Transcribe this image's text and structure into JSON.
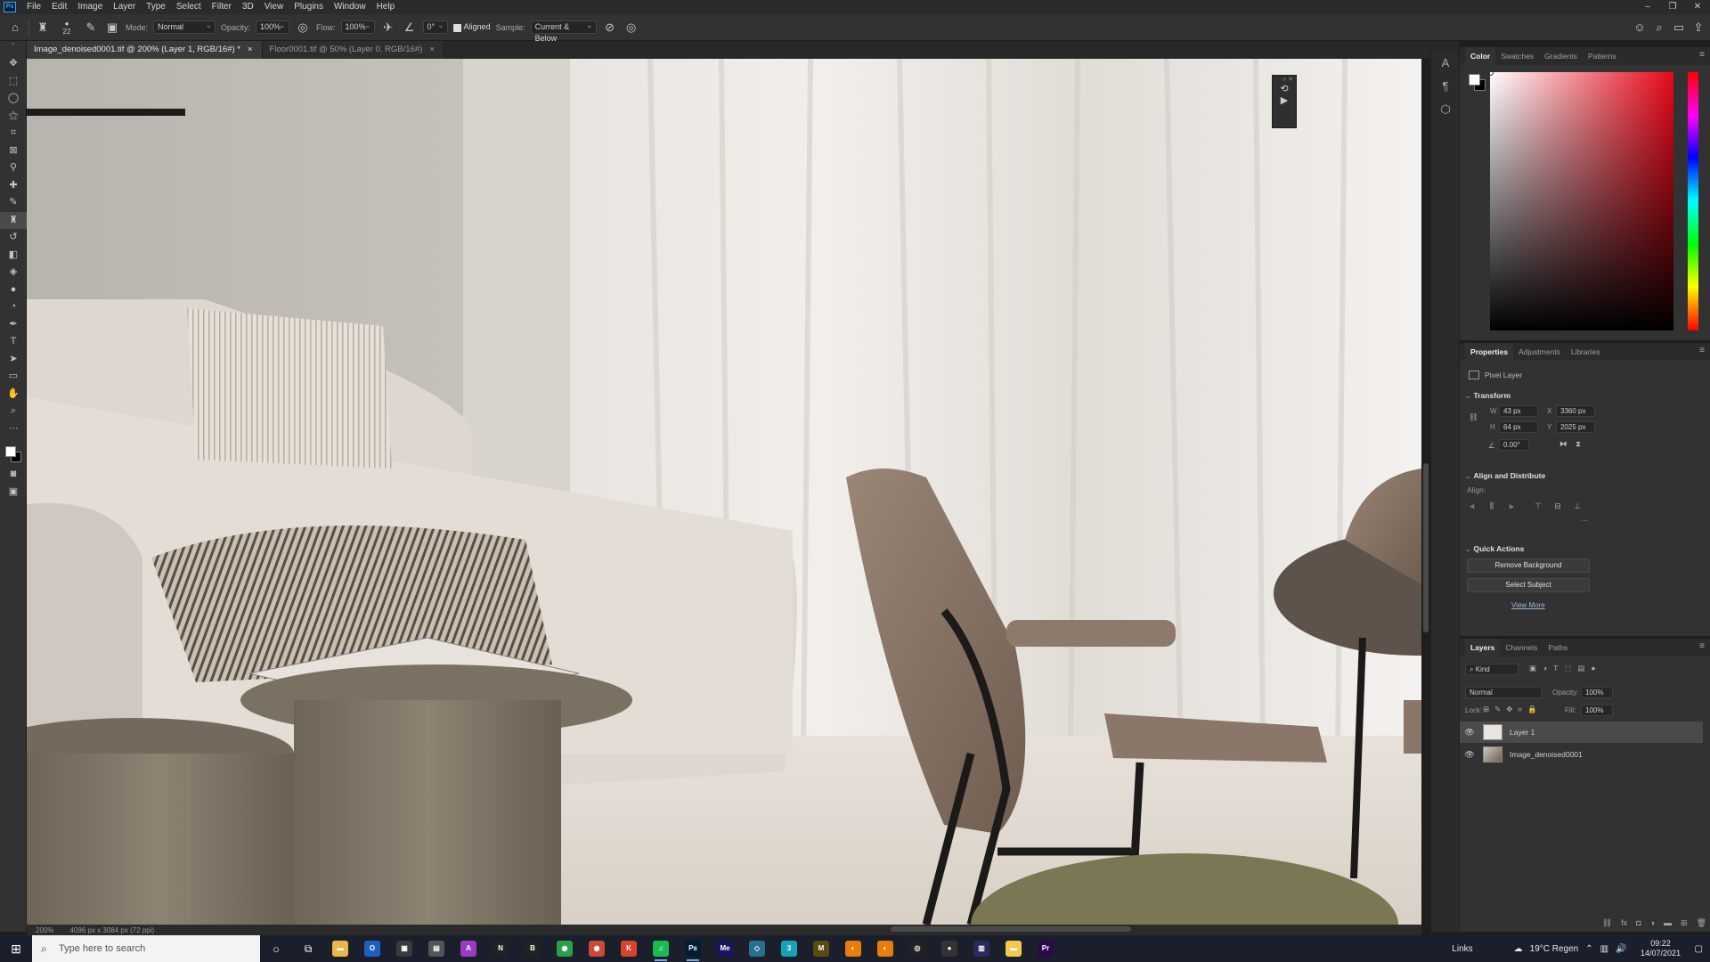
{
  "menubar": {
    "items": [
      "File",
      "Edit",
      "Image",
      "Layer",
      "Type",
      "Select",
      "Filter",
      "3D",
      "View",
      "Plugins",
      "Window",
      "Help"
    ]
  },
  "options": {
    "brush_size": "22",
    "mode_label": "Mode:",
    "mode_value": "Normal",
    "opacity_label": "Opacity:",
    "opacity_value": "100%",
    "flow_label": "Flow:",
    "flow_value": "100%",
    "angle_value": "0°",
    "aligned_label": "Aligned",
    "sample_label": "Sample:",
    "sample_value": "Current & Below"
  },
  "tabs": [
    {
      "label": "Image_denoised0001.tif @ 200% (Layer 1, RGB/16#) *",
      "close": "×"
    },
    {
      "label": "Floor0001.tif @ 50% (Layer 0, RGB/16#)",
      "close": "×"
    }
  ],
  "status": {
    "zoom": "200%",
    "doc_info": "4096 px x 3084 px (72 ppi)"
  },
  "color_panel": {
    "tabs": [
      "Color",
      "Swatches",
      "Gradients",
      "Patterns"
    ]
  },
  "properties_panel": {
    "tabs": [
      "Properties",
      "Adjustments",
      "Libraries"
    ],
    "layer_type": "Pixel Layer",
    "transform_title": "Transform",
    "w_label": "W",
    "w_value": "43 px",
    "h_label": "H",
    "h_value": "64 px",
    "x_label": "X",
    "x_value": "3360 px",
    "y_label": "Y",
    "y_value": "2025 px",
    "angle_value": "0.00°",
    "align_title": "Align and Distribute",
    "align_label": "Align:",
    "quick_actions_title": "Quick Actions",
    "remove_bg": "Remove Background",
    "select_subject": "Select Subject",
    "view_more": "View More"
  },
  "layers_panel": {
    "tabs": [
      "Layers",
      "Channels",
      "Paths"
    ],
    "filter_kind": "Kind",
    "blend_mode": "Normal",
    "opacity_label": "Opacity:",
    "opacity_value": "100%",
    "lock_label": "Lock:",
    "fill_label": "Fill:",
    "fill_value": "100%",
    "layers": [
      {
        "name": "Layer 1",
        "selected": true
      },
      {
        "name": "Image_denoised0001",
        "selected": false
      }
    ]
  },
  "taskbar": {
    "search_placeholder": "Type here to search",
    "links_label": "Links",
    "weather": "19°C Regen",
    "time": "09:22",
    "date": "14/07/2021",
    "apps": [
      {
        "name": "file-explorer",
        "glyph": "▬",
        "color": "#e8b84a"
      },
      {
        "name": "outlook",
        "glyph": "O",
        "color": "#1f5fbf"
      },
      {
        "name": "calculator",
        "glyph": "▦",
        "color": "#3a3a3a"
      },
      {
        "name": "app",
        "glyph": "▤",
        "color": "#555"
      },
      {
        "name": "affinity",
        "glyph": "A",
        "color": "#9b3bc4"
      },
      {
        "name": "app-n",
        "glyph": "N",
        "color": "#222"
      },
      {
        "name": "app-b",
        "glyph": "B",
        "color": "#222"
      },
      {
        "name": "chrome",
        "glyph": "◉",
        "color": "#2f9e4a"
      },
      {
        "name": "chrome-alt",
        "glyph": "◉",
        "color": "#c84a3a"
      },
      {
        "name": "app-k",
        "glyph": "K",
        "color": "#d6442b"
      },
      {
        "name": "spotify",
        "glyph": "♫",
        "color": "#1db954"
      },
      {
        "name": "photoshop",
        "glyph": "Ps",
        "color": "#001e36"
      },
      {
        "name": "media-encoder",
        "glyph": "Me",
        "color": "#1b1464"
      },
      {
        "name": "app-3d",
        "glyph": "◇",
        "color": "#2a6f8f"
      },
      {
        "name": "app-3",
        "glyph": "3",
        "color": "#17a2b8"
      },
      {
        "name": "app-m",
        "glyph": "M",
        "color": "#5a4a10"
      },
      {
        "name": "blender",
        "glyph": "◐",
        "color": "#e87d0d"
      },
      {
        "name": "blender-2",
        "glyph": "◐",
        "color": "#e87d0d"
      },
      {
        "name": "app-circle",
        "glyph": "◎",
        "color": "#222"
      },
      {
        "name": "obs",
        "glyph": "●",
        "color": "#333"
      },
      {
        "name": "app-grid",
        "glyph": "▥",
        "color": "#2a2a5a"
      },
      {
        "name": "sticky-notes",
        "glyph": "▬",
        "color": "#f2c94c"
      },
      {
        "name": "premiere",
        "glyph": "Pr",
        "color": "#2a0a4a"
      }
    ]
  },
  "colors": {
    "accent": "#31a8ff",
    "selected_layer": "#4a4a4a"
  }
}
